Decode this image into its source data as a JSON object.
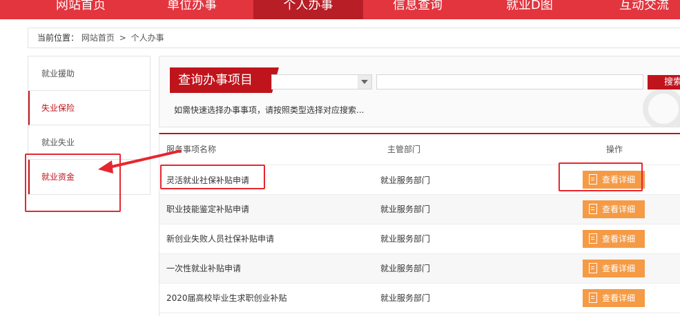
{
  "nav": {
    "items": [
      {
        "label": "网站首页"
      },
      {
        "label": "单位办事"
      },
      {
        "label": "个人办事"
      },
      {
        "label": "信息查询"
      },
      {
        "label": "就业D图"
      },
      {
        "label": "互动交流"
      }
    ]
  },
  "breadcrumb": {
    "prefix": "当前位置：",
    "home": "网站首页",
    "separator": ">",
    "current": "个人办事"
  },
  "sidebar": {
    "items": [
      {
        "label": "就业援助",
        "active": false
      },
      {
        "label": "失业保险",
        "active": true
      },
      {
        "label": "就业失业",
        "active": false
      },
      {
        "label": "就业资金",
        "active": true
      }
    ]
  },
  "search": {
    "title": "查询办事项目",
    "select_value": "",
    "input_value": "",
    "button_label": "搜索",
    "hint": "如需快速选择办事事项，请按照类型选择对应搜索..."
  },
  "table": {
    "headers": {
      "name": "服务事项名称",
      "dept": "主管部门",
      "op": "操作"
    },
    "rows": [
      {
        "name": "灵活就业社保补贴申请",
        "dept": "就业服务部门",
        "action": "查看详细"
      },
      {
        "name": "职业技能鉴定补贴申请",
        "dept": "就业服务部门",
        "action": "查看详细"
      },
      {
        "name": "新创业失败人员社保补贴申请",
        "dept": "就业服务部门",
        "action": "查看详细"
      },
      {
        "name": "一次性就业补贴申请",
        "dept": "就业服务部门",
        "action": "查看详细"
      },
      {
        "name": "2020届高校毕业生求职创业补贴",
        "dept": "就业服务部门",
        "action": "查看详细"
      }
    ]
  },
  "colors": {
    "brand_red": "#e2353e",
    "dark_red": "#c0141c",
    "button_orange": "#f59a45",
    "annotation_red": "#e5262f"
  },
  "icons": [
    "chevron-down-icon",
    "document-icon",
    "search-watermark-icon",
    "arrow-annotation"
  ]
}
